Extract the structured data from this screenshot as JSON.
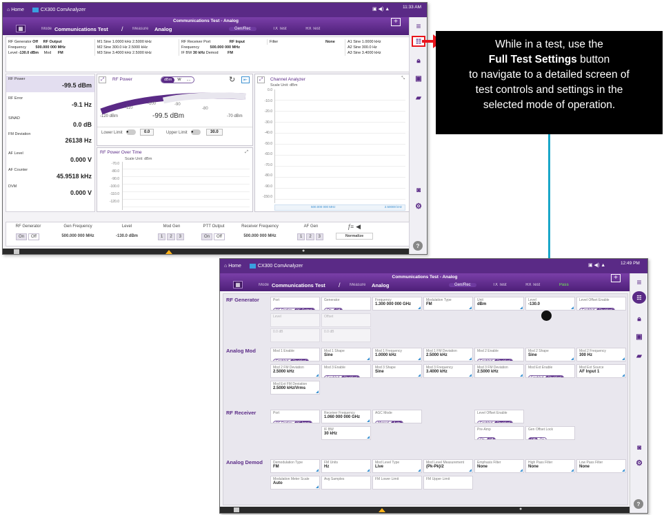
{
  "callout": {
    "line1": "While in a test, use the",
    "line2": "Full Test Settings",
    "line2b": " button",
    "line3": "to navigate to a detailed screen of",
    "line4": "test controls and settings in the",
    "line5": "selected mode of operation."
  },
  "colors": {
    "brand": "#5a2a86",
    "callout_arrow": "#e8141b",
    "connector": "#1aa6c8",
    "highlight": "#e8141b"
  },
  "s1": {
    "topbar": {
      "home": "Home",
      "app": "CX300 ComAnalyzer",
      "time": "11:33 AM"
    },
    "header": {
      "title": "Communications Test - Analog",
      "mode_label": "Mode",
      "mode": "Communications Test",
      "measure_label": "Measure",
      "measure": "Analog",
      "tabs": [
        "Gen/Rec",
        "TX Test",
        "RX Test"
      ]
    },
    "summary": {
      "rf_gen": "RF Generator",
      "rf_gen_val": "Off",
      "rf_out": "RF Output",
      "freq_l": "Frequency",
      "freq_v": "500.000 000 MHz",
      "level_l": "Level",
      "level_v": "-130.0 dBm",
      "mod_l": "Mod",
      "mod_v": "FM",
      "m1": "M1  Sine  1.0000 kHz  2.5000 kHz",
      "m2": "M2  Sine  300.0 Hz  2.5000 kHz",
      "m3": "M3  Sine  3.4000 kHz  2.5000 kHz",
      "rx_port": "RF Receiver Port",
      "rx_port_v": "RF Input",
      "rx_freq": "Frequency",
      "rx_freq_v": "500.000 000 MHz",
      "ifbw": "IF BW",
      "ifbw_v": "30 kHz",
      "demod": "Demod",
      "demod_v": "FM",
      "filter": "Filter",
      "filter_v": "None",
      "a1": "A1  Sine  1.0000 kHz",
      "a2": "A2  Sine  300.0 Hz",
      "a3": "A3  Sine  3.4000 kHz"
    },
    "meters": [
      {
        "label": "RF Power",
        "value": "-99.5 dBm"
      },
      {
        "label": "RF Error",
        "value": "-9.1 Hz"
      },
      {
        "label": "SINAD",
        "value": "0.0 dB"
      },
      {
        "label": "FM Deviation",
        "value": "26138 Hz"
      },
      {
        "label": "AF Level",
        "value": "0.000 V"
      },
      {
        "label": "AF Counter",
        "value": "45.9518 kHz"
      },
      {
        "label": "DVM",
        "value": "0.000 V"
      }
    ],
    "rfpower": {
      "title": "RF Power",
      "unit_sel": "dBm",
      "unit2": "W",
      "reading": "-99.5 dBm",
      "min": "-120 dBm",
      "max": "-70 dBm",
      "ticks": [
        "-110",
        "-100",
        "-90",
        "-80"
      ],
      "lower": "Lower Limit",
      "lower_v": "0.0",
      "upper": "Upper Limit",
      "upper_v": "30.0"
    },
    "overtime": {
      "title": "RF Power Over Time",
      "scale": "Scale Unit: dBm",
      "y": [
        "-70.0",
        "-80.0",
        "-90.0",
        "-100.0",
        "-110.0",
        "-120.0"
      ]
    },
    "chan": {
      "title": "Channel Analyzer",
      "scale": "Scale Unit: dBm",
      "y": [
        "0.0",
        "-10.0",
        "-20.0",
        "-30.0",
        "-40.0",
        "-50.0",
        "-60.0",
        "-70.0",
        "-80.0",
        "-90.0",
        "-150.0"
      ],
      "center": "500.000 000 MHz",
      "span": "2.50000 kHz"
    },
    "gens": [
      {
        "title": "RF Generator",
        "a": "On",
        "b": "Off"
      },
      {
        "title": "Gen Frequency",
        "v": "500.000 000 MHz"
      },
      {
        "title": "Level",
        "v": "-130.0 dBm"
      },
      {
        "title": "Mod Gen",
        "a": "1",
        "b": "2",
        "c": "3"
      },
      {
        "title": "PTT Output",
        "a": "On",
        "b": "Off"
      },
      {
        "title": "Receiver Frequency",
        "v": "500.000 000 MHz"
      },
      {
        "title": "AF Gen",
        "a": "1",
        "b": "2",
        "c": "3"
      },
      {
        "title": "Normalize"
      }
    ]
  },
  "s2": {
    "topbar": {
      "home": "Home",
      "app": "CX300 ComAnalyzer",
      "time": "12:49 PM"
    },
    "header": {
      "title": "Communications Test - Analog",
      "mode_label": "Mode",
      "mode": "Communications Test",
      "measure_label": "Measure",
      "measure": "Analog",
      "tabs": [
        "Gen/Rec",
        "TX Test",
        "RX Test",
        "Pass"
      ]
    },
    "sections": {
      "rfgen": "RF Generator",
      "amod": "Analog Mod",
      "rfrec": "RF Receiver",
      "ademod": "Analog Demod"
    },
    "rfgen_row": [
      {
        "l": "Port",
        "t": [
          "RF Duplex",
          "RF Output"
        ],
        "on": 1
      },
      {
        "l": "Generator",
        "t": [
          "On",
          "Off"
        ],
        "on": 1
      },
      {
        "l": "Frequency",
        "v": "1.300 000 000 GHz"
      },
      {
        "l": "Modulation Type",
        "v": "FM"
      },
      {
        "l": "Unit",
        "v": "dBm"
      },
      {
        "l": "Level",
        "v": "-130.0"
      },
      {
        "l": "Level Offset Enable",
        "t": [
          "Enabled",
          "Disabled"
        ],
        "on": 1
      }
    ],
    "rfgen_row2": [
      "Level",
      "Offset",
      "0.0 dB",
      "0.0 dB"
    ],
    "amod_row1": [
      {
        "l": "Mod 1 Enable",
        "t": [
          "Enabled",
          "Disabled"
        ],
        "on": 1
      },
      {
        "l": "Mod 1 Shape",
        "v": "Sine"
      },
      {
        "l": "Mod 1 Frequency",
        "v": "1.0000 kHz"
      },
      {
        "l": "Mod 1 FM Deviation",
        "v": "2.5000 kHz"
      },
      {
        "l": "Mod 2 Enable",
        "t": [
          "Enabled",
          "Disabled"
        ],
        "on": 1
      },
      {
        "l": "Mod 2 Shape",
        "v": "Sine"
      },
      {
        "l": "Mod 2 Frequency",
        "v": "300 Hz"
      }
    ],
    "amod_row2": [
      {
        "l": "Mod 2 FM Deviation",
        "v": "2.5000 kHz"
      },
      {
        "l": "Mod 3 Enable",
        "t": [
          "Enabled",
          "Disabled"
        ],
        "on": 1
      },
      {
        "l": "Mod 3 Shape",
        "v": "Sine"
      },
      {
        "l": "Mod 3 Frequency",
        "v": "3.4000 kHz"
      },
      {
        "l": "Mod 3 FM Deviation",
        "v": "2.5000 kHz"
      },
      {
        "l": "Mod Ext Enable",
        "t": [
          "Enabled",
          "Disabled"
        ],
        "on": 1
      },
      {
        "l": "Mod Ext Source",
        "v": "AF Input 1"
      }
    ],
    "amod_row3": {
      "l": "Mod Ext FM Deviation",
      "v": "2.5000 kHz/Vrms"
    },
    "rfrec_row1": [
      {
        "l": "Port",
        "t": [
          "RF Duplex",
          "RF Input"
        ],
        "on": 1
      },
      {
        "l": "Receiver Frequency",
        "v": "1.060 000 000 GHz"
      },
      {
        "l": "AGC Mode",
        "t": [
          "Manual",
          "Auto"
        ],
        "on": 1
      },
      {
        "l": "Level Offset Enable",
        "t": [
          "Enabled",
          "Disabled"
        ],
        "on": 1
      }
    ],
    "rfrec_row2": [
      {
        "l": "IF BW",
        "v": "30 kHz"
      },
      {
        "l": "Pre-Amp",
        "t": [
          "On",
          "Off"
        ],
        "on": 1
      },
      {
        "l": "Gen Offset Lock",
        "t": [
          "Off",
          "On"
        ],
        "on": 0
      }
    ],
    "ademod_row1": [
      {
        "l": "Demodulation Type",
        "v": "FM"
      },
      {
        "l": "FM Units",
        "v": "Hz"
      },
      {
        "l": "Mod Level Type",
        "v": "Live"
      },
      {
        "l": "Mod Level Measurement",
        "v": "(Pk-Pk)/2"
      },
      {
        "l": "Emphasis Filter",
        "v": "None"
      },
      {
        "l": "High Pass Filter",
        "v": "None"
      },
      {
        "l": "Low Pass Filter",
        "v": "None"
      }
    ],
    "ademod_row2": [
      {
        "l": "Modulation Meter Scale",
        "v": "Auto"
      },
      {
        "l": "Avg Samples"
      },
      {
        "l": "FM Lower Limit"
      },
      {
        "l": "FM Upper Limit"
      }
    ]
  }
}
